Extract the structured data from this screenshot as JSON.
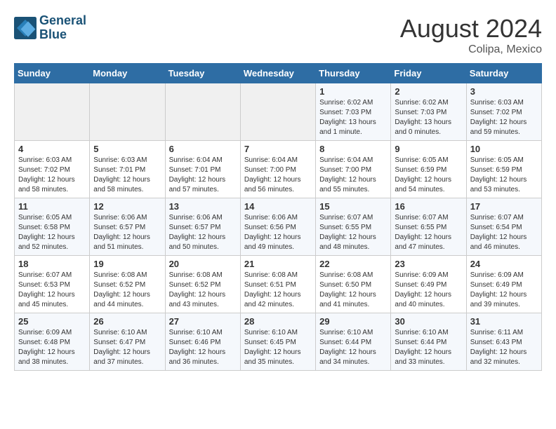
{
  "header": {
    "logo_line1": "General",
    "logo_line2": "Blue",
    "month_year": "August 2024",
    "location": "Colipa, Mexico"
  },
  "days_of_week": [
    "Sunday",
    "Monday",
    "Tuesday",
    "Wednesday",
    "Thursday",
    "Friday",
    "Saturday"
  ],
  "weeks": [
    [
      {
        "day": "",
        "info": ""
      },
      {
        "day": "",
        "info": ""
      },
      {
        "day": "",
        "info": ""
      },
      {
        "day": "",
        "info": ""
      },
      {
        "day": "1",
        "info": "Sunrise: 6:02 AM\nSunset: 7:03 PM\nDaylight: 13 hours\nand 1 minute."
      },
      {
        "day": "2",
        "info": "Sunrise: 6:02 AM\nSunset: 7:03 PM\nDaylight: 13 hours\nand 0 minutes."
      },
      {
        "day": "3",
        "info": "Sunrise: 6:03 AM\nSunset: 7:02 PM\nDaylight: 12 hours\nand 59 minutes."
      }
    ],
    [
      {
        "day": "4",
        "info": "Sunrise: 6:03 AM\nSunset: 7:02 PM\nDaylight: 12 hours\nand 58 minutes."
      },
      {
        "day": "5",
        "info": "Sunrise: 6:03 AM\nSunset: 7:01 PM\nDaylight: 12 hours\nand 58 minutes."
      },
      {
        "day": "6",
        "info": "Sunrise: 6:04 AM\nSunset: 7:01 PM\nDaylight: 12 hours\nand 57 minutes."
      },
      {
        "day": "7",
        "info": "Sunrise: 6:04 AM\nSunset: 7:00 PM\nDaylight: 12 hours\nand 56 minutes."
      },
      {
        "day": "8",
        "info": "Sunrise: 6:04 AM\nSunset: 7:00 PM\nDaylight: 12 hours\nand 55 minutes."
      },
      {
        "day": "9",
        "info": "Sunrise: 6:05 AM\nSunset: 6:59 PM\nDaylight: 12 hours\nand 54 minutes."
      },
      {
        "day": "10",
        "info": "Sunrise: 6:05 AM\nSunset: 6:59 PM\nDaylight: 12 hours\nand 53 minutes."
      }
    ],
    [
      {
        "day": "11",
        "info": "Sunrise: 6:05 AM\nSunset: 6:58 PM\nDaylight: 12 hours\nand 52 minutes."
      },
      {
        "day": "12",
        "info": "Sunrise: 6:06 AM\nSunset: 6:57 PM\nDaylight: 12 hours\nand 51 minutes."
      },
      {
        "day": "13",
        "info": "Sunrise: 6:06 AM\nSunset: 6:57 PM\nDaylight: 12 hours\nand 50 minutes."
      },
      {
        "day": "14",
        "info": "Sunrise: 6:06 AM\nSunset: 6:56 PM\nDaylight: 12 hours\nand 49 minutes."
      },
      {
        "day": "15",
        "info": "Sunrise: 6:07 AM\nSunset: 6:55 PM\nDaylight: 12 hours\nand 48 minutes."
      },
      {
        "day": "16",
        "info": "Sunrise: 6:07 AM\nSunset: 6:55 PM\nDaylight: 12 hours\nand 47 minutes."
      },
      {
        "day": "17",
        "info": "Sunrise: 6:07 AM\nSunset: 6:54 PM\nDaylight: 12 hours\nand 46 minutes."
      }
    ],
    [
      {
        "day": "18",
        "info": "Sunrise: 6:07 AM\nSunset: 6:53 PM\nDaylight: 12 hours\nand 45 minutes."
      },
      {
        "day": "19",
        "info": "Sunrise: 6:08 AM\nSunset: 6:52 PM\nDaylight: 12 hours\nand 44 minutes."
      },
      {
        "day": "20",
        "info": "Sunrise: 6:08 AM\nSunset: 6:52 PM\nDaylight: 12 hours\nand 43 minutes."
      },
      {
        "day": "21",
        "info": "Sunrise: 6:08 AM\nSunset: 6:51 PM\nDaylight: 12 hours\nand 42 minutes."
      },
      {
        "day": "22",
        "info": "Sunrise: 6:08 AM\nSunset: 6:50 PM\nDaylight: 12 hours\nand 41 minutes."
      },
      {
        "day": "23",
        "info": "Sunrise: 6:09 AM\nSunset: 6:49 PM\nDaylight: 12 hours\nand 40 minutes."
      },
      {
        "day": "24",
        "info": "Sunrise: 6:09 AM\nSunset: 6:49 PM\nDaylight: 12 hours\nand 39 minutes."
      }
    ],
    [
      {
        "day": "25",
        "info": "Sunrise: 6:09 AM\nSunset: 6:48 PM\nDaylight: 12 hours\nand 38 minutes."
      },
      {
        "day": "26",
        "info": "Sunrise: 6:10 AM\nSunset: 6:47 PM\nDaylight: 12 hours\nand 37 minutes."
      },
      {
        "day": "27",
        "info": "Sunrise: 6:10 AM\nSunset: 6:46 PM\nDaylight: 12 hours\nand 36 minutes."
      },
      {
        "day": "28",
        "info": "Sunrise: 6:10 AM\nSunset: 6:45 PM\nDaylight: 12 hours\nand 35 minutes."
      },
      {
        "day": "29",
        "info": "Sunrise: 6:10 AM\nSunset: 6:44 PM\nDaylight: 12 hours\nand 34 minutes."
      },
      {
        "day": "30",
        "info": "Sunrise: 6:10 AM\nSunset: 6:44 PM\nDaylight: 12 hours\nand 33 minutes."
      },
      {
        "day": "31",
        "info": "Sunrise: 6:11 AM\nSunset: 6:43 PM\nDaylight: 12 hours\nand 32 minutes."
      }
    ]
  ]
}
